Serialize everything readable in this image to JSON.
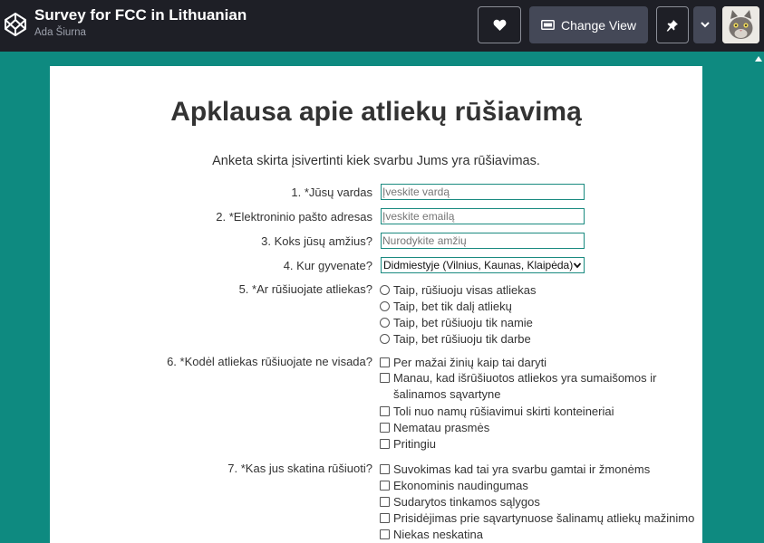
{
  "header": {
    "title": "Survey for FCC in Lithuanian",
    "author": "Ada Šiurna",
    "change_view_label": "Change View"
  },
  "icons": {
    "logo": "codepen-logo-icon",
    "heart": "heart-icon",
    "view": "change-view-icon",
    "pin": "pin-icon",
    "caret": "chevron-down-icon",
    "avatar": "cat-avatar-icon"
  },
  "colors": {
    "topbar": "#1e1f26",
    "background": "#0e8a80",
    "field_border": "#1a8a80"
  },
  "survey": {
    "title": "Apklausa apie atliekų rūšiavimą",
    "description": "Anketa skirta įsivertinti kiek svarbu Jums yra rūšiavimas.",
    "q1": {
      "label": "1. *Jūsų vardas",
      "placeholder": "Įveskite vardą"
    },
    "q2": {
      "label": "2. *Elektroninio pašto adresas",
      "placeholder": "Įveskite emailą"
    },
    "q3": {
      "label": "3. Koks jūsų amžius?",
      "placeholder": "Nurodykite amžių"
    },
    "q4": {
      "label": "4. Kur gyvenate?",
      "selected": "Didmiestyje (Vilnius, Kaunas, Klaipėda)"
    },
    "q5": {
      "label": "5. *Ar rūšiuojate atliekas?",
      "options": [
        "Taip, rūšiuoju visas atliekas",
        "Taip, bet tik dalį atliekų",
        "Taip, bet rūšiuoju tik namie",
        "Taip, bet rūšiuoju tik darbe"
      ]
    },
    "q6": {
      "label": "6. *Kodėl atliekas rūšiuojate ne visada?",
      "options": [
        "Per mažai žinių kaip tai daryti",
        "Manau, kad išrūšiuotos atliekos yra sumaišomos ir šalinamos sąvartyne",
        "Toli nuo namų rūšiavimui skirti konteineriai",
        "Nematau prasmės",
        "Pritingiu"
      ]
    },
    "q7": {
      "label": "7. *Kas jus skatina rūšiuoti?",
      "options": [
        "Suvokimas kad tai yra svarbu gamtai ir žmonėms",
        "Ekonominis naudingumas",
        "Sudarytos tinkamos sąlygos",
        "Prisidėjimas prie sąvartynuose šalinamų atliekų mažinimo",
        "Niekas neskatina"
      ]
    }
  }
}
